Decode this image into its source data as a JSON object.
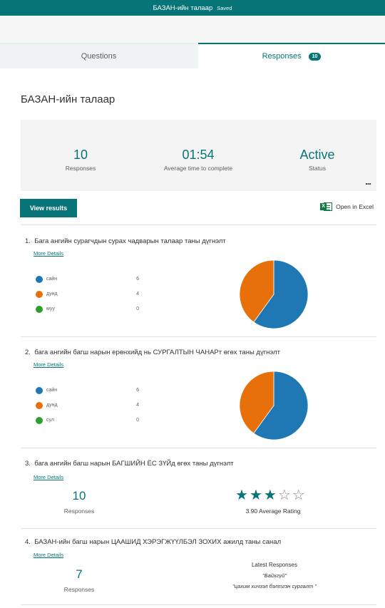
{
  "header": {
    "title": "БАЗАН-ийн талаар",
    "saved": "Saved"
  },
  "tabs": {
    "questions": "Questions",
    "responses": "Responses",
    "responses_count": "10"
  },
  "form_title": "БАЗАН-ийн талаар",
  "summary": {
    "responses_value": "10",
    "responses_label": "Responses",
    "time_value": "01:54",
    "time_label": "Average time to complete",
    "status_value": "Active",
    "status_label": "Status",
    "more_menu": "..."
  },
  "actions": {
    "view_results": "View results",
    "open_excel": "Open in Excel"
  },
  "colors": {
    "accent": "#077578",
    "blue": "#1f77b4",
    "orange": "#e8700a",
    "green": "#2ca02c"
  },
  "questions": [
    {
      "number": "1.",
      "title": "Бага ангийн сурагчдын сурах чадварын талаар таны дүгнэлт",
      "more": "More Details",
      "options": [
        {
          "label": "сайн",
          "count": "6"
        },
        {
          "label": "дунд",
          "count": "4"
        },
        {
          "label": "муу",
          "count": "0"
        }
      ]
    },
    {
      "number": "2.",
      "title": "бага ангийн багш нарын ерөнхийд нь СУРГАЛТЫН ЧАНАРт өгөх таны дүгнэлт",
      "more": "More Details",
      "options": [
        {
          "label": "сайн",
          "count": "6"
        },
        {
          "label": "дунд",
          "count": "4"
        },
        {
          "label": "сул",
          "count": "0"
        }
      ]
    },
    {
      "number": "3.",
      "title": "бага ангийн багш нарын БАГШИЙН ЁС ЗҮЙд өгөх таны дүгнэлт",
      "more": "More Details",
      "responses_value": "10",
      "responses_label": "Responses",
      "rating_value": 3.9,
      "rating_max": 5,
      "rating_label": "3.90 Average Rating"
    },
    {
      "number": "4.",
      "title": "БАЗАН-ийн багш нарын ЦААШИД ХЭРЭГЖҮҮЛБЭЛ ЗОХИХ ажилд таны санал",
      "more": "More Details",
      "responses_value": "7",
      "responses_label": "Responses",
      "latest_label": "Latest Responses",
      "latest": [
        "\"Байхгүй\"",
        "\"цахим хичээл бэлтгэн сургалт \""
      ]
    }
  ]
}
